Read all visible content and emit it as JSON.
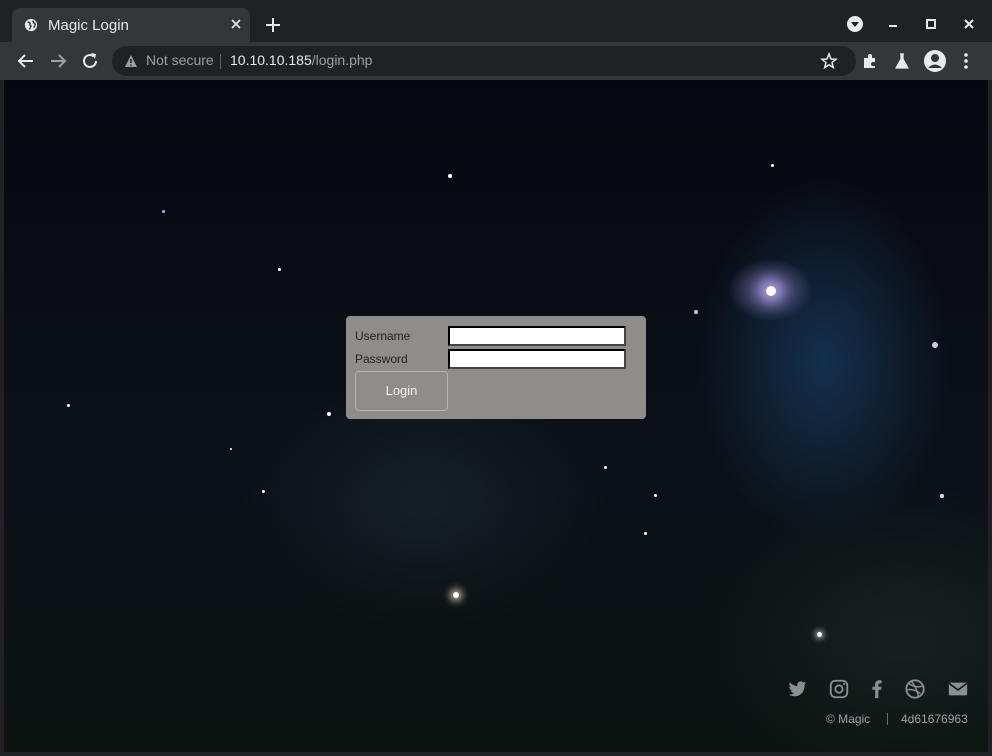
{
  "browser": {
    "tab_title": "Magic Login",
    "security_label": "Not secure",
    "url_host": "10.10.10.185",
    "url_path": "/login.php",
    "icons": [
      "globe-icon",
      "close-icon",
      "plus-icon",
      "profile-dropdown-icon",
      "minimize-icon",
      "maximize-icon",
      "window-close-icon",
      "back-arrow-icon",
      "forward-arrow-icon",
      "reload-icon",
      "warning-icon",
      "star-icon",
      "extensions-icon",
      "labs-icon",
      "account-icon",
      "menu-icon"
    ]
  },
  "login": {
    "username_label": "Username",
    "password_label": "Password",
    "username_value": "",
    "password_value": "",
    "button_label": "Login"
  },
  "footer": {
    "copyright": "© Magic",
    "hash": "4d61676963",
    "social_icons": [
      "twitter-icon",
      "instagram-icon",
      "facebook-icon",
      "dribbble-icon",
      "email-icon"
    ]
  },
  "colors": {
    "chrome_dark": "#202124",
    "chrome_toolbar": "#35363a",
    "login_panel": "#8f8d89"
  }
}
